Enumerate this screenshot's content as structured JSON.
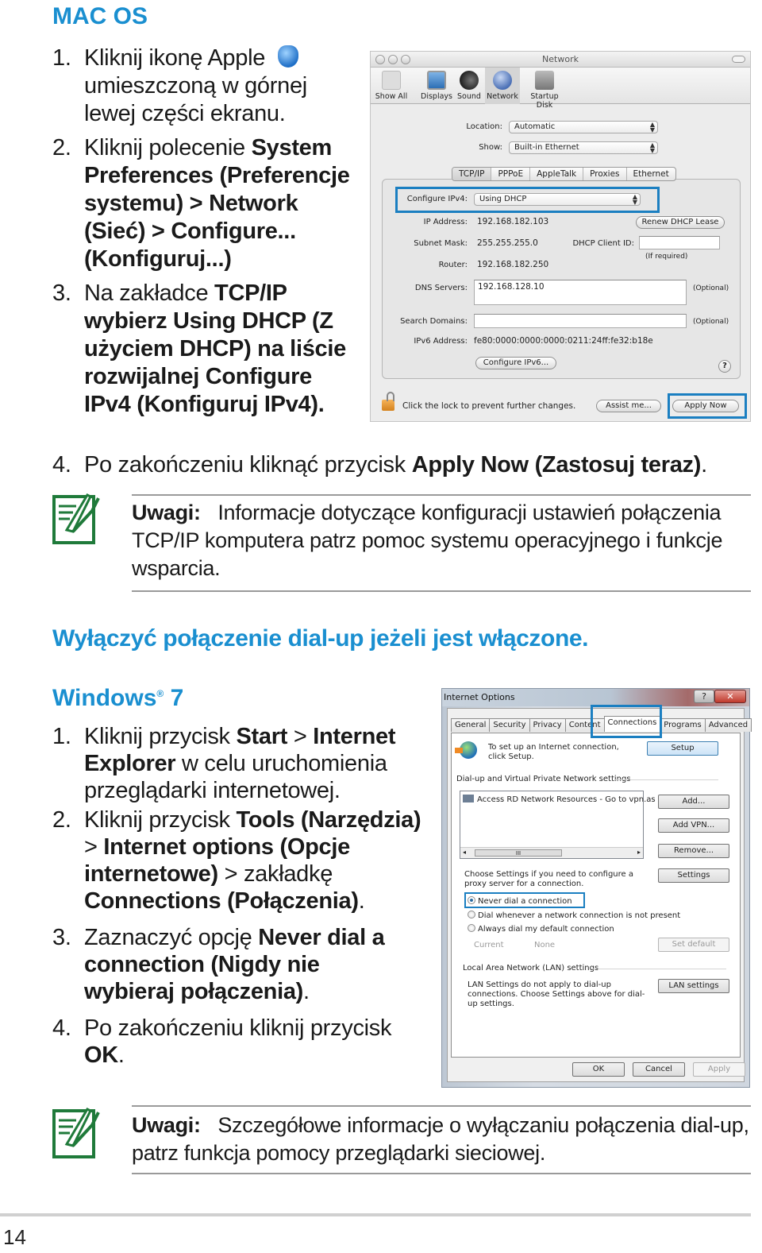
{
  "mac_section": {
    "heading": "MAC OS",
    "steps": [
      {
        "num": "1.",
        "parts": [
          "Kliknij ikonę Apple",
          " umieszczoną w górnej lewej części ekranu."
        ]
      },
      {
        "num": "2.",
        "prefix": "Kliknij polecenie ",
        "bold": "System Preferences (Preferencje systemu) > Network (Sieć) > Configure... (Konfiguruj...)"
      },
      {
        "num": "3.",
        "prefix": "Na zakładce ",
        "bold1": "TCP/IP",
        "mid": " ",
        "bold2": "wybierz Using DHCP (Z użyciem DHCP) na liście rozwijalnej Configure IPv4 (Konfiguruj IPv4)."
      },
      {
        "num": "4.",
        "prefix": "Po zakończeniu kliknąć przycisk ",
        "bold": "Apply Now (Zastosuj teraz)",
        "suffix": "."
      }
    ],
    "note": {
      "label": "Uwagi:",
      "text": "Informacje dotyczące konfiguracji ustawień połączenia TCP/IP komputera patrz pomoc systemu operacyjnego i funkcje wsparcia."
    }
  },
  "mac_window": {
    "title": "Network",
    "toolbar": [
      "Show All",
      "Displays",
      "Sound",
      "Network",
      "Startup Disk"
    ],
    "location_label": "Location:",
    "location_value": "Automatic",
    "show_label": "Show:",
    "show_value": "Built-in Ethernet",
    "tabs": [
      "TCP/IP",
      "PPPoE",
      "AppleTalk",
      "Proxies",
      "Ethernet"
    ],
    "configure_label": "Configure IPv4:",
    "configure_value": "Using DHCP",
    "ip_label": "IP Address:",
    "ip_value": "192.168.182.103",
    "renew_button": "Renew DHCP Lease",
    "subnet_label": "Subnet Mask:",
    "subnet_value": "255.255.255.0",
    "client_id_label": "DHCP Client ID:",
    "if_required": "(If required)",
    "router_label": "Router:",
    "router_value": "192.168.182.250",
    "dns_label": "DNS Servers:",
    "dns_value": "192.168.128.10",
    "optional": "(Optional)",
    "search_label": "Search Domains:",
    "search_value": "",
    "ipv6_label": "IPv6 Address:",
    "ipv6_value": "fe80:0000:0000:0000:0211:24ff:fe32:b18e",
    "configure_ipv6_button": "Configure IPv6...",
    "help": "?",
    "lock_text": "Click the lock to prevent further changes.",
    "assist_button": "Assist me...",
    "apply_button": "Apply Now"
  },
  "dialup_heading": "Wyłączyć połączenie dial-up jeżeli jest włączone.",
  "win_section": {
    "heading": "Windows",
    "heading_sup": "®",
    "heading_ver": " 7",
    "steps": [
      {
        "num": "1.",
        "prefix": "Kliknij przycisk ",
        "b1": "Start",
        "mid1": " > ",
        "b2": "Internet Explorer",
        "suffix": " w celu uruchomienia przeglądarki internetowej."
      },
      {
        "num": "2.",
        "prefix": "Kliknij przycisk ",
        "b1": "Tools (Narzędzia)",
        "mid1": " > ",
        "b2": "Internet options (Opcje internetowe)",
        "mid2": " > zakładkę ",
        "b3": "Connections (Połączenia)",
        "suffix": "."
      },
      {
        "num": "3.",
        "prefix": "Zaznaczyć opcję ",
        "b1": "Never dial a connection (Nigdy nie wybieraj połączenia)",
        "suffix": "."
      },
      {
        "num": "4.",
        "prefix": "Po zakończeniu kliknij przycisk ",
        "b1": "OK",
        "suffix": "."
      }
    ],
    "note": {
      "label": "Uwagi:",
      "text": "Szczegółowe informacje o wyłączaniu połączenia dial-up, patrz funkcja pomocy przeglądarki sieciowej."
    }
  },
  "win_window": {
    "title": "Internet Options",
    "help": "?",
    "close": "✕",
    "tabs": [
      "General",
      "Security",
      "Privacy",
      "Content",
      "Connections",
      "Programs",
      "Advanced"
    ],
    "setup_text": "To set up an Internet connection, click Setup.",
    "setup_button": "Setup",
    "dialup_group": "Dial-up and Virtual Private Network settings",
    "list_item": "Access RD Network Resources - Go to vpn.as",
    "scroll_grip": "III",
    "add_button": "Add...",
    "add_vpn_button": "Add VPN...",
    "remove_button": "Remove...",
    "proxy_text": "Choose Settings if you need to configure a proxy server for a connection.",
    "settings_button": "Settings",
    "radio_never": "Never dial a connection",
    "radio_whenever": "Dial whenever a network connection is not present",
    "radio_always": "Always dial my default connection",
    "current_label": "Current",
    "current_value": "None",
    "set_default_button": "Set default",
    "lan_group": "Local Area Network (LAN) settings",
    "lan_text": "LAN Settings do not apply to dial-up connections. Choose Settings above for dial-up settings.",
    "lan_button": "LAN settings",
    "ok_button": "OK",
    "cancel_button": "Cancel",
    "apply_button": "Apply"
  },
  "page_number": "14",
  "colors": {
    "heading_blue": "#1a8fd0",
    "highlight_blue": "#1b7fc1",
    "note_green": "#1f7a3a"
  }
}
